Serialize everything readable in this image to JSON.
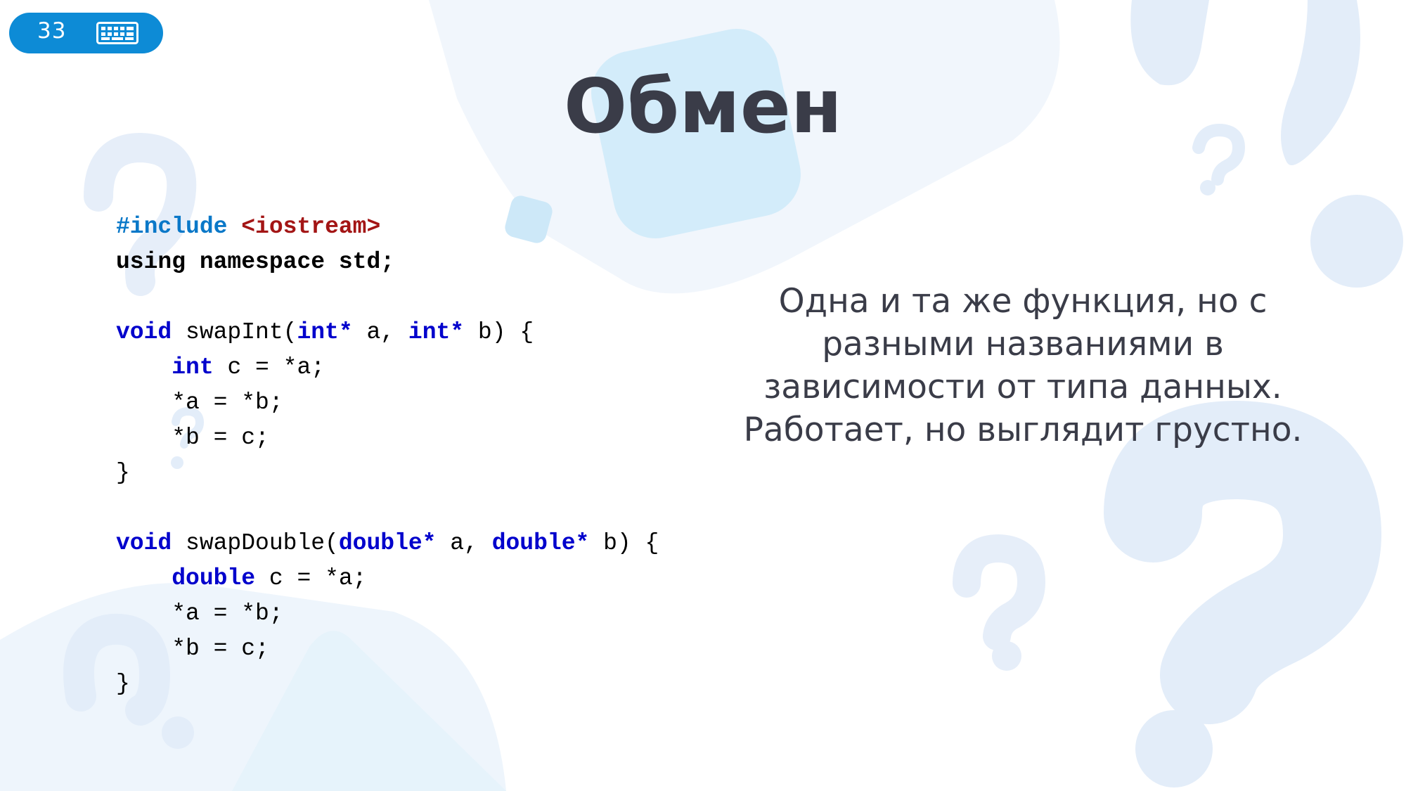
{
  "slide": {
    "number": "33",
    "title": "Обмен",
    "description_lines": [
      "Одна и та же функция, но с",
      "разными названиями в",
      "зависимости от типа данных.",
      "Работает, но выглядит грустно."
    ]
  },
  "icons": {
    "badge_icon": "keyboard-icon",
    "background": "question-mark-shapes"
  },
  "colors": {
    "badge": "#0d8bd6",
    "title": "#3a3c48",
    "keyword": "#0000cc",
    "preprocessor": "#0a78c8",
    "include_path": "#a31515",
    "decor_light": "#e3edf9",
    "decor_blue": "#d3ecfa"
  },
  "code": {
    "l1_directive": "#include",
    "l1_path": "<iostream>",
    "l2": "using namespace std;",
    "l3_kw": "void",
    "l3_name": " swapInt(",
    "l3_t1": "int*",
    "l3_a": " a, ",
    "l3_t2": "int*",
    "l3_b": " b) {",
    "l4_indent": "    ",
    "l4_kw": "int",
    "l4_rest": " c = *a;",
    "l5": "    *a = *b;",
    "l6": "    *b = c;",
    "l7": "}",
    "l8_kw": "void",
    "l8_name": " swapDouble(",
    "l8_t1": "double*",
    "l8_a": " a, ",
    "l8_t2": "double*",
    "l8_b": " b) {",
    "l9_indent": "    ",
    "l9_kw": "double",
    "l9_rest": " c = *a;",
    "l10": "    *a = *b;",
    "l11": "    *b = c;",
    "l12": "}"
  }
}
